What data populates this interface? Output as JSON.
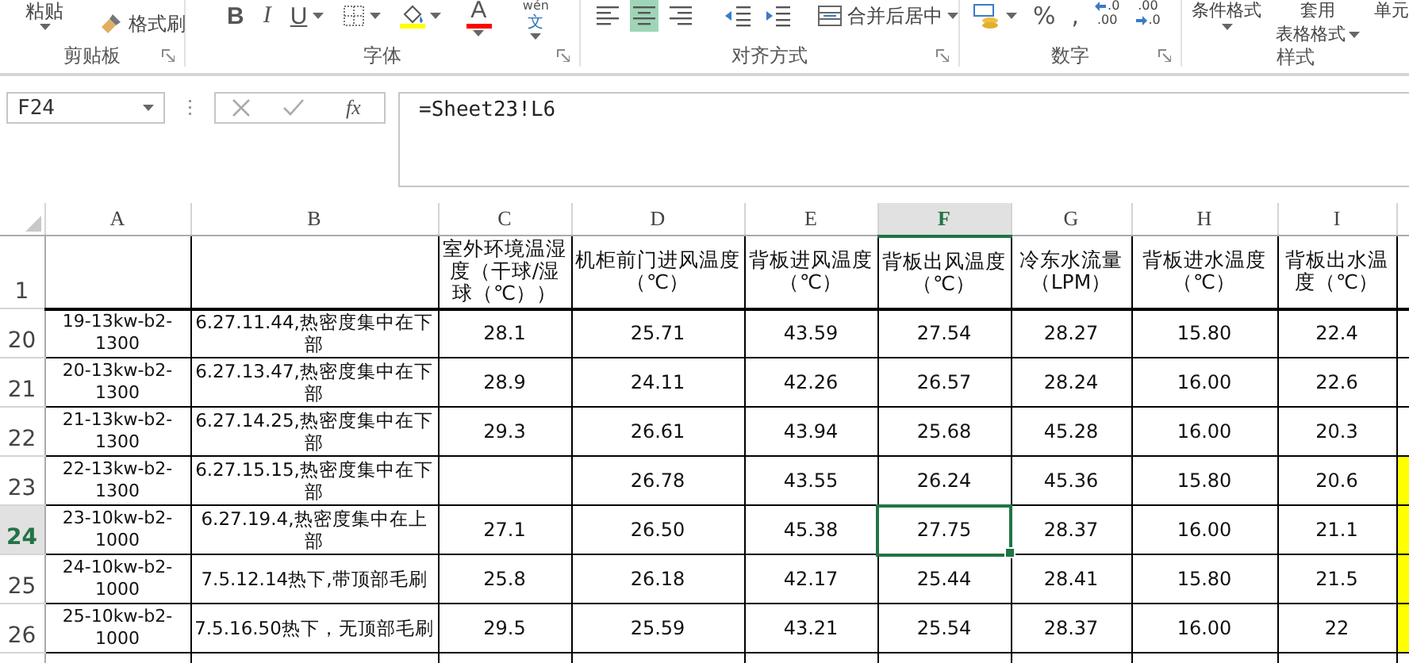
{
  "ribbon": [
    {
      "label": "剪贴板",
      "launcher": true,
      "items": [
        {
          "kind": "paste",
          "label": "粘贴",
          "dropdown": true
        },
        {
          "kind": "format-painter",
          "label": "格式刷"
        }
      ]
    },
    {
      "label": "字体",
      "launcher": true,
      "items": [
        {
          "kind": "bold",
          "label": "B"
        },
        {
          "kind": "italic",
          "label": "I"
        },
        {
          "kind": "underline",
          "label": "U",
          "dropdown": true
        },
        {
          "kind": "borders",
          "dropdown": true
        },
        {
          "kind": "fill-color",
          "color": "#ffff00",
          "dropdown": true
        },
        {
          "kind": "font-color",
          "label": "A",
          "color": "#ff0000",
          "dropdown": true
        },
        {
          "kind": "phonetic",
          "label": "wén",
          "label2": "文",
          "dropdown": true
        }
      ]
    },
    {
      "label": "对齐方式",
      "launcher": true,
      "items": [
        {
          "kind": "align-left",
          "selected": false
        },
        {
          "kind": "align-center",
          "selected": true
        },
        {
          "kind": "align-right",
          "selected": false
        },
        {
          "kind": "outdent"
        },
        {
          "kind": "indent"
        },
        {
          "kind": "merge",
          "label": "合并后居中",
          "dropdown": true
        }
      ]
    },
    {
      "label": "数字",
      "launcher": true,
      "items": [
        {
          "kind": "accounting",
          "dropdown": true
        },
        {
          "kind": "percent",
          "label": "%"
        },
        {
          "kind": "comma",
          "label": ","
        },
        {
          "kind": "increase-decimal",
          "label": ".0",
          "label2": ".00"
        },
        {
          "kind": "decrease-decimal",
          "label": ".00",
          "label2": ".0"
        }
      ]
    },
    {
      "label": "样式",
      "launcher": false,
      "items": [
        {
          "kind": "conditional-format",
          "label": "条件格式",
          "dropdown": true
        },
        {
          "kind": "format-table",
          "label": "套用",
          "label2": "表格格式",
          "dropdown": true
        },
        {
          "kind": "cell-styles",
          "label": "单元"
        }
      ]
    }
  ],
  "name_box": "F24",
  "function_label": "fx",
  "formula": "=Sheet23!L6",
  "columns": [
    {
      "label": "A",
      "selected": false
    },
    {
      "label": "B",
      "selected": false
    },
    {
      "label": "C",
      "selected": false
    },
    {
      "label": "D",
      "selected": false
    },
    {
      "label": "E",
      "selected": false
    },
    {
      "label": "F",
      "selected": true
    },
    {
      "label": "G",
      "selected": false
    },
    {
      "label": "H",
      "selected": false
    },
    {
      "label": "I",
      "selected": false
    }
  ],
  "header_row": {
    "row": "1",
    "cells": [
      null,
      null,
      "室外环境温湿度（干球/湿球（℃））",
      "机柜前门进风温度（℃）",
      "背板进风温度（℃）",
      "背板出风温度（℃）",
      "冷东水流量（LPM）",
      "背板进水温度（℃）",
      "背板出水温度（℃）"
    ]
  },
  "rows": [
    {
      "row": "20",
      "selected": false,
      "cells": [
        "19-13kw-b2-1300",
        "6.27.11.44,热密度集中在下部",
        "28.1",
        "25.71",
        "43.59",
        "27.54",
        "28.27",
        "15.80",
        "22.4"
      ]
    },
    {
      "row": "21",
      "selected": false,
      "cells": [
        "20-13kw-b2-1300",
        "6.27.13.47,热密度集中在下部",
        "28.9",
        "24.11",
        "42.26",
        "26.57",
        "28.24",
        "16.00",
        "22.6"
      ]
    },
    {
      "row": "22",
      "selected": false,
      "cells": [
        "21-13kw-b2-1300",
        "6.27.14.25,热密度集中在下部",
        "29.3",
        "26.61",
        "43.94",
        "25.68",
        "45.28",
        "16.00",
        "20.3"
      ]
    },
    {
      "row": "23",
      "selected": false,
      "color": "#ffff00",
      "cells": [
        "22-13kw-b2-1300",
        "6.27.15.15,热密度集中在下部",
        null,
        "26.78",
        "43.55",
        "26.24",
        "45.36",
        "15.80",
        "20.6"
      ]
    },
    {
      "row": "24",
      "selected": true,
      "color": "#ffff00",
      "cells": [
        "23-10kw-b2-1000",
        "6.27.19.4,热密度集中在上部",
        "27.1",
        "26.50",
        "45.38",
        "27.75",
        "28.37",
        "16.00",
        "21.1"
      ]
    },
    {
      "row": "25",
      "selected": false,
      "color": "#ffff00",
      "cells": [
        "24-10kw-b2-1000",
        "7.5.12.14热下,带顶部毛刷",
        "25.8",
        "26.18",
        "42.17",
        "25.44",
        "28.41",
        "15.80",
        "21.5"
      ]
    },
    {
      "row": "26",
      "selected": false,
      "color": "#ffff00",
      "cells": [
        "25-10kw-b2-1000",
        "7.5.16.50热下，无顶部毛刷",
        "29.5",
        "25.59",
        "43.21",
        "25.54",
        "28.37",
        "16.00",
        "22"
      ]
    }
  ]
}
